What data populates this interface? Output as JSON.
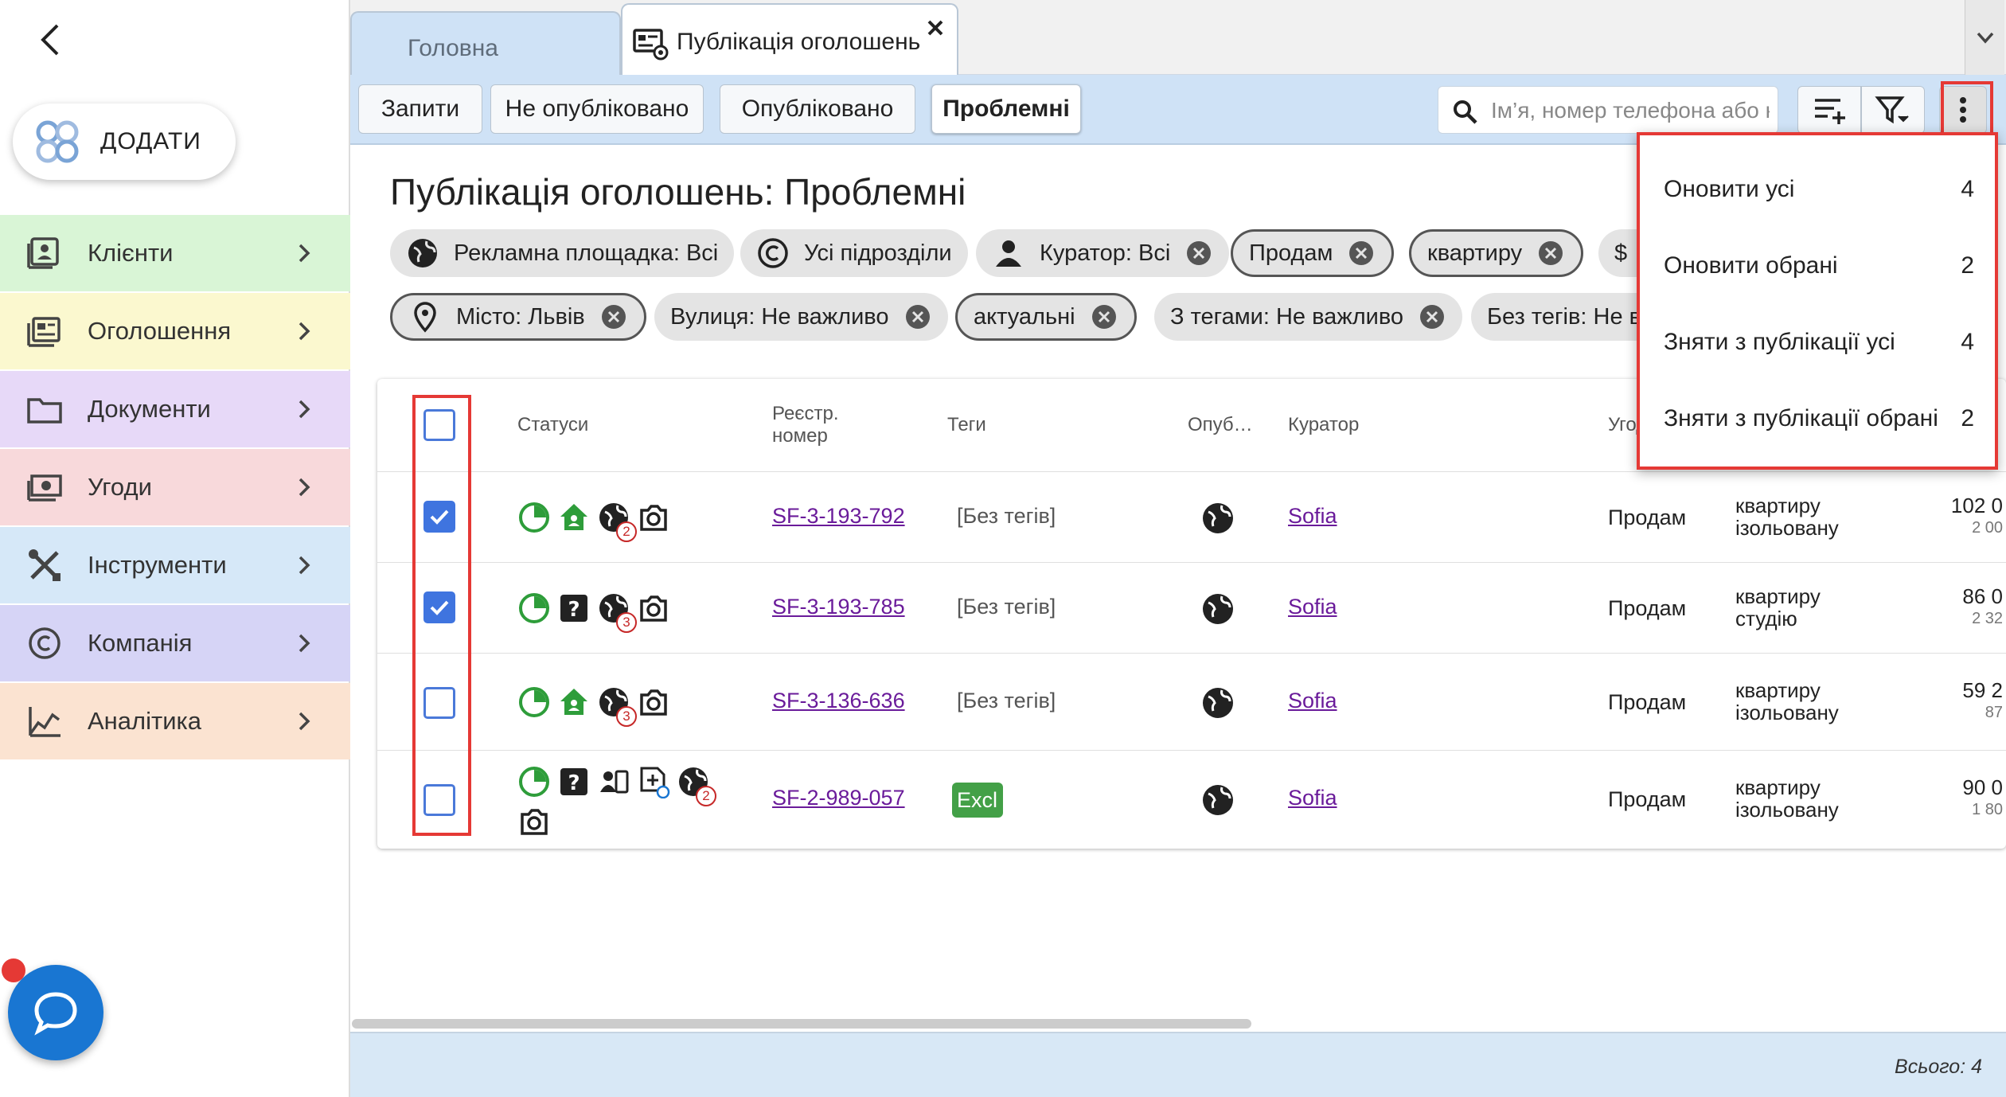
{
  "sidebar": {
    "add_label": "ДОДАТИ",
    "items": [
      {
        "label": "Клієнти",
        "bg": "#d9f5d6"
      },
      {
        "label": "Оголошення",
        "bg": "#fbf8cf"
      },
      {
        "label": "Документи",
        "bg": "#e7d9f8"
      },
      {
        "label": "Угоди",
        "bg": "#f8d9db"
      },
      {
        "label": "Інструменти",
        "bg": "#d6e8f8"
      },
      {
        "label": "Компанія",
        "bg": "#d6d4f6"
      },
      {
        "label": "Аналітика",
        "bg": "#fbe3d1"
      }
    ]
  },
  "tabs": {
    "home": "Головна",
    "publication": "Публікація оголошень"
  },
  "toolbar": {
    "segments": [
      "Запити",
      "Не опубліковано",
      "Опубліковано",
      "Проблемні"
    ],
    "active_segment": "Проблемні",
    "search_placeholder": "Ім’я, номер телефона або н"
  },
  "page": {
    "title": "Публікація оголошень: Проблемні"
  },
  "filters": {
    "row1": [
      "Рекламна площадка: Всі",
      "Усі підрозділи",
      "Куратор: Всі",
      "Продам",
      "квартиру",
      "$"
    ],
    "row2": [
      "Місто: Львів",
      "Вулиця: Не важливо",
      "актуальні",
      "З тегами: Не важливо",
      "Без тегів: Не в"
    ]
  },
  "table": {
    "headers": {
      "statuses": "Статуси",
      "reg_line1": "Реєстр.",
      "reg_line2": "номер",
      "tags": "Теги",
      "published": "Опуб…",
      "curator": "Куратор",
      "deal": "Угод"
    },
    "rows": [
      {
        "checked": true,
        "reg": "SF-3-193-792",
        "tags": "[Без тегів]",
        "curator": "Sofia",
        "deal": "Продам",
        "type1": "квартиру",
        "type2": "ізольовану",
        "price1": "102 0",
        "price2": "2 00",
        "globe_badge": "2"
      },
      {
        "checked": true,
        "reg": "SF-3-193-785",
        "tags": "[Без тегів]",
        "curator": "Sofia",
        "deal": "Продам",
        "type1": "квартиру",
        "type2": "студію",
        "price1": "86 0",
        "price2": "2 32",
        "globe_badge": "3"
      },
      {
        "checked": false,
        "reg": "SF-3-136-636",
        "tags": "[Без тегів]",
        "curator": "Sofia",
        "deal": "Продам",
        "type1": "квартиру",
        "type2": "ізольовану",
        "price1": "59 2",
        "price2": "87",
        "globe_badge": "3"
      },
      {
        "checked": false,
        "reg": "SF-2-989-057",
        "tags": "Excl",
        "curator": "Sofia",
        "deal": "Продам",
        "type1": "квартиру",
        "type2": "ізольовану",
        "price1": "90 0",
        "price2": "1 80",
        "globe_badge": "2"
      }
    ]
  },
  "menu": {
    "items": [
      {
        "label": "Оновити усі",
        "count": "4"
      },
      {
        "label": "Оновити обрані",
        "count": "2"
      },
      {
        "label": "Зняти з публікації усі",
        "count": "4"
      },
      {
        "label": "Зняти з публікації обрані",
        "count": "2"
      }
    ]
  },
  "footer": {
    "total": "Всього: 4"
  },
  "colors": {
    "accent": "#1976d2",
    "highlight": "#e53935",
    "status_green": "#2e9d3a",
    "link": "#6a1b9a"
  }
}
